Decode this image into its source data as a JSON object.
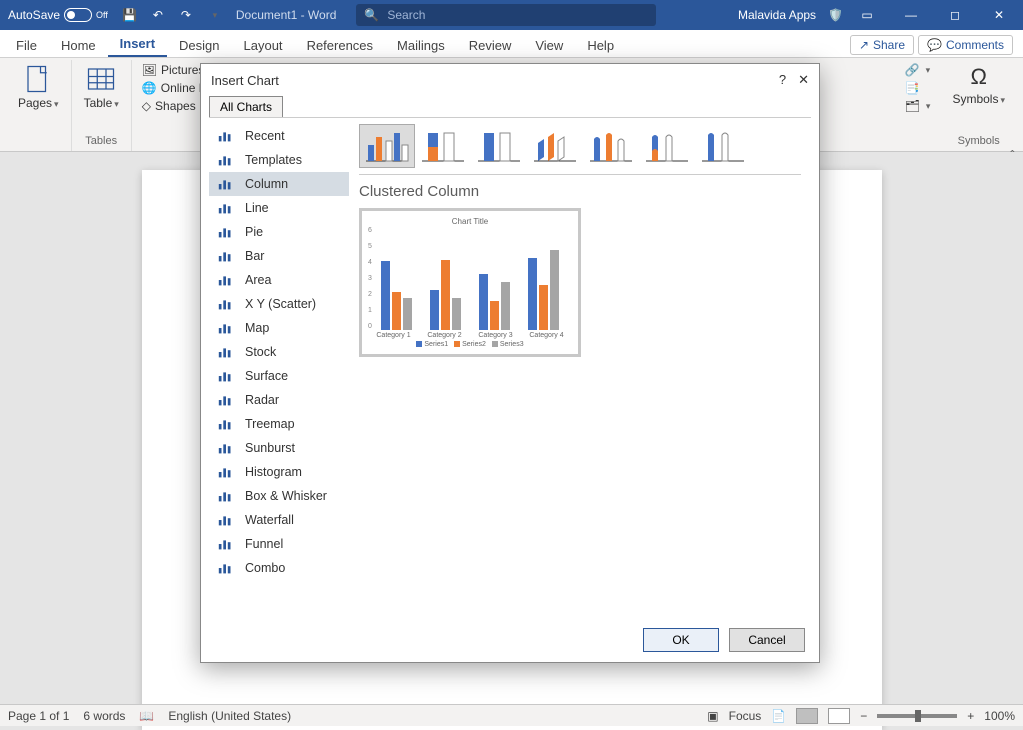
{
  "titlebar": {
    "autosave_label": "AutoSave",
    "autosave_state": "Off",
    "doc_name": "Document1",
    "app_suffix": " - Word",
    "search_placeholder": "Search",
    "user": "Malavida Apps"
  },
  "ribbon": {
    "tabs": [
      "File",
      "Home",
      "Insert",
      "Design",
      "Layout",
      "References",
      "Mailings",
      "Review",
      "View",
      "Help"
    ],
    "active_tab_index": 2,
    "share": "Share",
    "comments": "Comments",
    "groups": {
      "pages": "Pages",
      "tables": "Tables",
      "table_btn": "Table",
      "pictures": "Pictures",
      "online_pic": "Online Pic",
      "shapes": "Shapes",
      "symbols_group": "Symbols",
      "symbols_btn": "Symbols"
    }
  },
  "dialog": {
    "title": "Insert Chart",
    "tab": "All Charts",
    "categories": [
      "Recent",
      "Templates",
      "Column",
      "Line",
      "Pie",
      "Bar",
      "Area",
      "X Y (Scatter)",
      "Map",
      "Stock",
      "Surface",
      "Radar",
      "Treemap",
      "Sunburst",
      "Histogram",
      "Box & Whisker",
      "Waterfall",
      "Funnel",
      "Combo"
    ],
    "selected_category_index": 2,
    "selected_subtype_index": 0,
    "subtype_heading": "Clustered Column",
    "ok": "OK",
    "cancel": "Cancel"
  },
  "chart_data": {
    "type": "bar",
    "title": "Chart Title",
    "categories": [
      "Category 1",
      "Category 2",
      "Category 3",
      "Category 4"
    ],
    "series": [
      {
        "name": "Series1",
        "values": [
          4.3,
          2.5,
          3.5,
          4.5
        ]
      },
      {
        "name": "Series2",
        "values": [
          2.4,
          4.4,
          1.8,
          2.8
        ]
      },
      {
        "name": "Series3",
        "values": [
          2.0,
          2.0,
          3.0,
          5.0
        ]
      }
    ],
    "ylim": [
      0,
      6
    ],
    "yticks": [
      0,
      1,
      2,
      3,
      4,
      5,
      6
    ]
  },
  "statusbar": {
    "page": "Page 1 of 1",
    "words": "6 words",
    "language": "English (United States)",
    "focus": "Focus",
    "zoom": "100%"
  }
}
